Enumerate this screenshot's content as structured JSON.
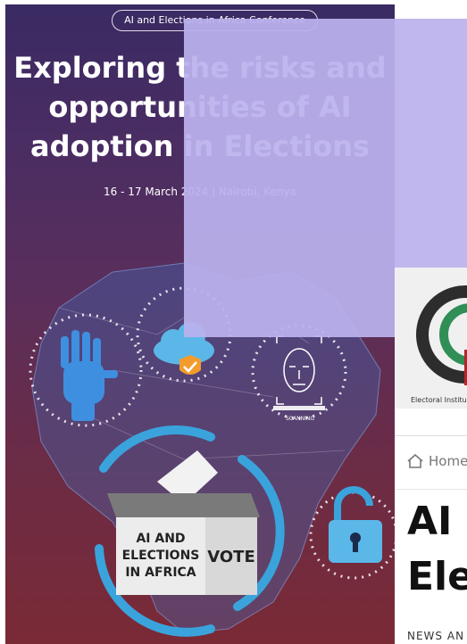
{
  "poster": {
    "pill": "AI and Elections in Africa Conference",
    "title_lines": [
      "Exploring the risks and",
      "opportunities of AI",
      "adoption in Elections"
    ],
    "dates": "16 - 17 March 2024 | Nairobi, Kenya",
    "scanning_label": "SCANNING",
    "ballot_box": {
      "line1": "AI AND",
      "line2": "ELECTIONS",
      "line3": "IN AFRICA",
      "vote": "VOTE"
    }
  },
  "site": {
    "logo_caption": "Electoral Institu",
    "home": "Home",
    "headline_line1": "AI a",
    "headline_line2": "Ele",
    "section": "NEWS AN"
  },
  "colors": {
    "overlay": "#bbb2ee",
    "accent_blue": "#3aa3dc",
    "shield_orange": "#f39c2c"
  }
}
